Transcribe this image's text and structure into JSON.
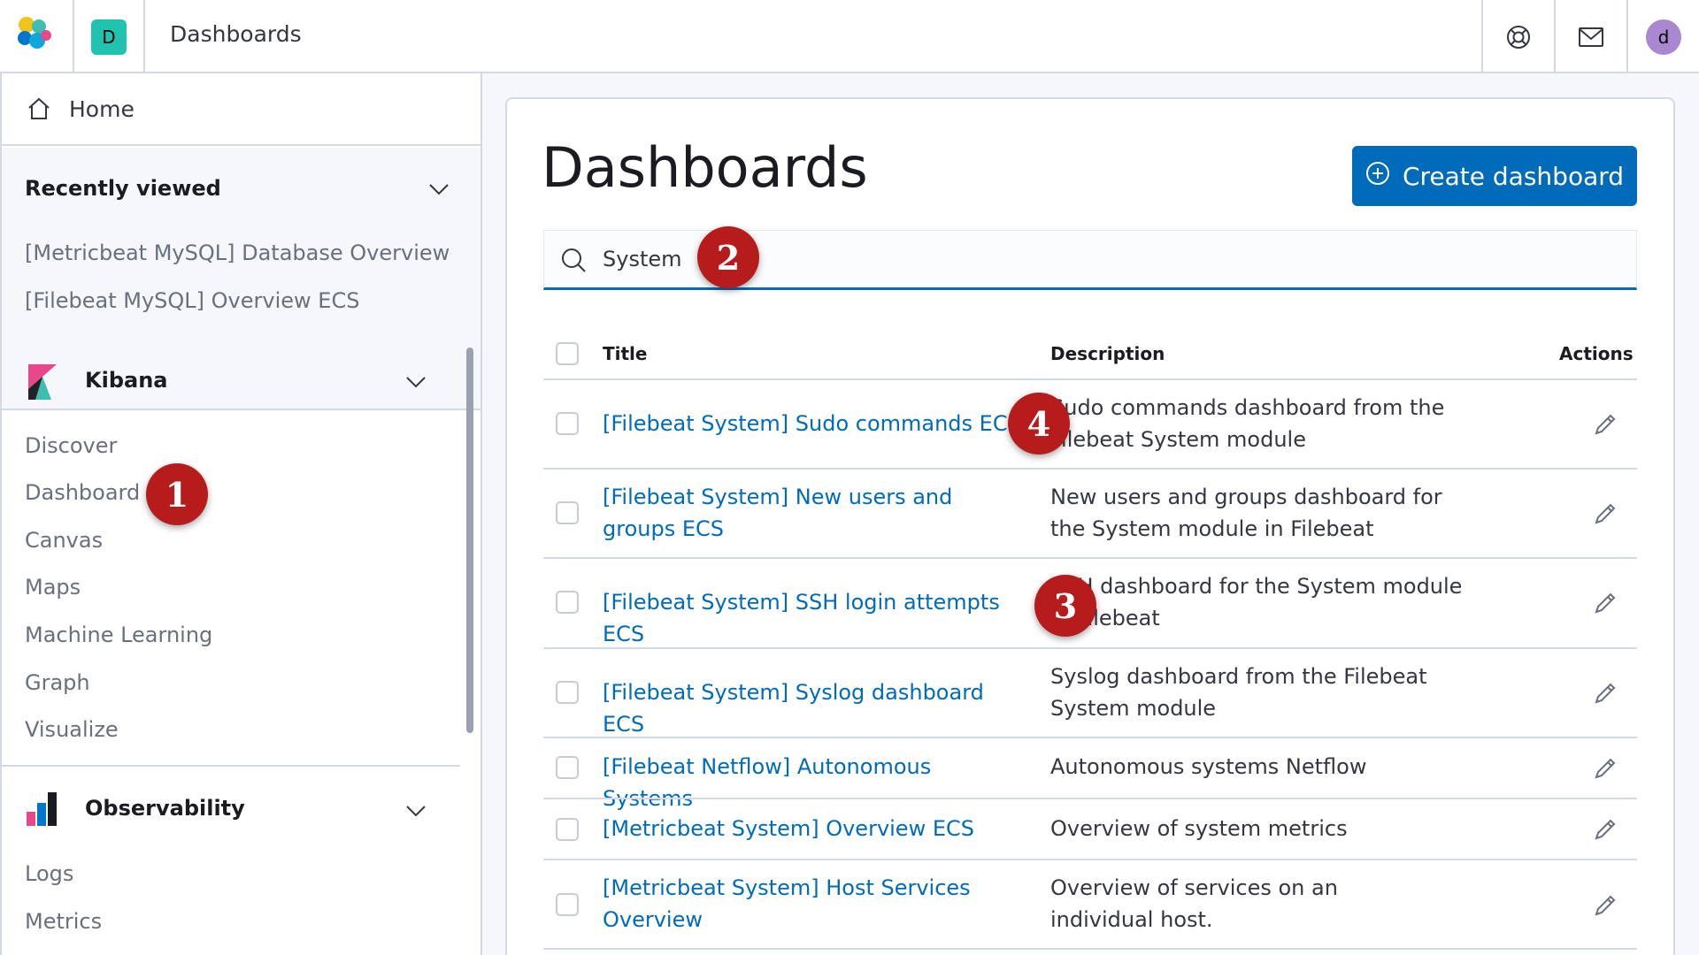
{
  "header": {
    "space_initial": "D",
    "title": "Dashboards",
    "user_initial": "d"
  },
  "sidebar": {
    "home_label": "Home",
    "recently_viewed": {
      "title": "Recently viewed",
      "items": [
        "[Metricbeat MySQL] Database Overview",
        "[Filebeat MySQL] Overview ECS"
      ]
    },
    "kibana": {
      "title": "Kibana",
      "items": [
        "Discover",
        "Dashboard",
        "Canvas",
        "Maps",
        "Machine Learning",
        "Graph",
        "Visualize"
      ]
    },
    "observability": {
      "title": "Observability",
      "items": [
        "Logs",
        "Metrics"
      ]
    }
  },
  "main": {
    "page_title": "Dashboards",
    "create_button": "Create dashboard",
    "search_value": "System",
    "columns": {
      "title": "Title",
      "description": "Description",
      "actions": "Actions"
    },
    "rows": [
      {
        "title": "[Filebeat System] Sudo commands ECS",
        "description": "Sudo commands dashboard from the Filebeat System module"
      },
      {
        "title": "[Filebeat System] New users and groups ECS",
        "description": "New users and groups dashboard for the System module in Filebeat"
      },
      {
        "title": "[Filebeat System] SSH login attempts ECS",
        "description": "SSH dashboard for the System module in Filebeat"
      },
      {
        "title": "[Filebeat System] Syslog dashboard ECS",
        "description": "Syslog dashboard from the Filebeat System module"
      },
      {
        "title": "[Filebeat Netflow] Autonomous Systems",
        "description": "Autonomous systems Netflow"
      },
      {
        "title": "[Metricbeat System] Overview ECS",
        "description": "Overview of system metrics"
      },
      {
        "title": "[Metricbeat System] Host Services Overview",
        "description": "Overview of services on an individual host."
      }
    ]
  },
  "markers": [
    "1",
    "2",
    "3",
    "4"
  ],
  "colors": {
    "primary": "#006bb8",
    "marker": "#b71c1c",
    "space_badge": "#20c3b0",
    "avatar": "#a987d1"
  }
}
